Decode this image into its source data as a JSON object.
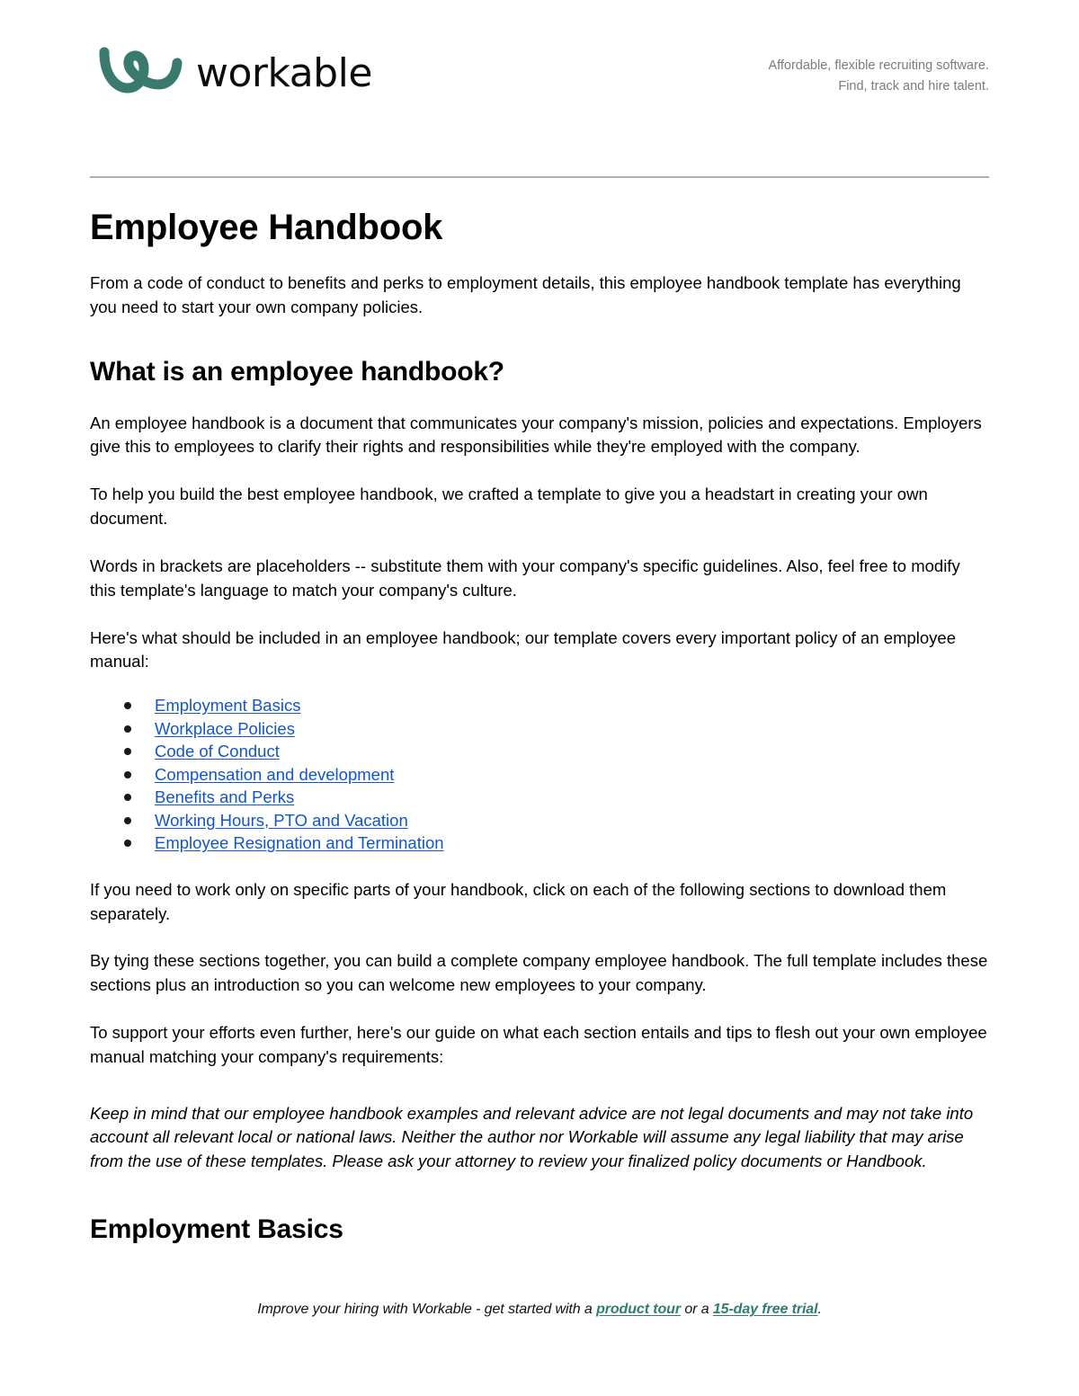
{
  "header": {
    "logo_icon": "workable-swoosh-logo",
    "wordmark": "workable",
    "tagline_line1": "Affordable, flexible recruiting software.",
    "tagline_line2": "Find, track and hire talent.",
    "brand_color": "#3a7a6e",
    "tagline_color": "#7c7c7c",
    "rule_color": "#b0b0b0"
  },
  "document": {
    "title": "Employee Handbook",
    "intro": "From a code of conduct to benefits and perks to employment details, this employee handbook template has everything you need to start your own company policies.",
    "section_what_is": {
      "heading": "What is an employee handbook?",
      "p1": "An employee handbook is a document that communicates your company's mission, policies and expectations. Employers give this to employees to clarify their rights and responsibilities while they're employed with the company.",
      "p2": "To help you build the best employee handbook, we crafted a template to give you a headstart in creating your own document.",
      "p3": "Words in brackets are placeholders -- substitute them with your company's specific guidelines. Also, feel free to modify this template's language to match your company's culture.",
      "p4": "Here's what should be included in an employee handbook; our template covers every important policy of an employee manual:",
      "links": [
        {
          "label": "Employment Basics"
        },
        {
          "label": "Workplace Policies"
        },
        {
          "label": "Code of Conduct"
        },
        {
          "label": "Compensation and development"
        },
        {
          "label": "Benefits and Perks"
        },
        {
          "label": "Working Hours, PTO and Vacation"
        },
        {
          "label": "Employee Resignation and Termination"
        }
      ],
      "link_color": "#1155cc",
      "p5": "If you need to work only on specific parts of your handbook, click on each of the following sections to download them separately.",
      "p6": "By tying these sections together, you can build a complete company employee handbook. The full template includes these sections plus an introduction so you can welcome new employees to your company.",
      "p7": "To support your efforts even further, here's our guide on what each section entails and tips to flesh out your own employee manual matching your company's requirements:",
      "disclaimer": "Keep in mind that our employee handbook examples and relevant advice are not legal documents and may not take into account all relevant local or national laws. Neither the author nor Workable will assume any legal liability that may arise from the use of these templates. Please ask your attorney to review your finalized policy documents or Handbook."
    },
    "section_employment_basics": {
      "heading": "Employment Basics"
    }
  },
  "footer": {
    "text_before": "Improve your hiring with Workable - get started with a ",
    "link1": "product tour",
    "text_between": " or a ",
    "link2": "15-day free trial",
    "text_after": ".",
    "link_color": "#2e7d6f"
  }
}
